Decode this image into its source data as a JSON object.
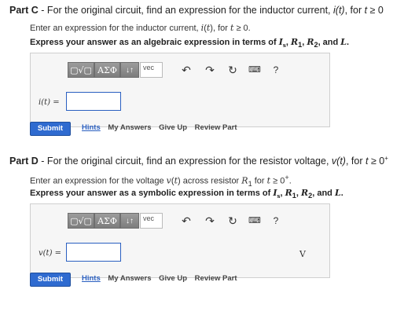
{
  "part_c": {
    "label": "Part C",
    "header": "For the original circuit, find an expression for the inductor current, i(t), for t ≥ 0",
    "instruction_text": "Enter an expression for the inductor current, i(t), for t ≥ 0.",
    "express_text": "Express your answer as an algebraic expression in terms of Is, R1, R2, and L.",
    "eq_label": "i(t) =",
    "input_value": "",
    "unit": "",
    "submit": "Submit",
    "links": [
      "Hints",
      "My Answers",
      "Give Up",
      "Review Part"
    ]
  },
  "part_d": {
    "label": "Part D",
    "header": "For the original circuit, find an expression for the resistor voltage, v(t), for t ≥ 0+",
    "instruction_text": "Enter an expression for the voltage v(t) across resistor R1 for t ≥ 0+.",
    "express_text": "Express your answer as a symbolic expression in terms of Is, R1, R2, and L.",
    "eq_label": "v(t) =",
    "input_value": "",
    "unit": "V",
    "submit": "Submit",
    "links": [
      "Hints",
      "My Answers",
      "Give Up",
      "Review Part"
    ]
  },
  "toolbar": {
    "radical": "▢√▢",
    "greek": "ΑΣΦ",
    "arrows": "↓↑",
    "vec": "vec",
    "icons": [
      "undo-icon",
      "redo-icon",
      "reset-icon",
      "keyboard-icon",
      "help-icon"
    ],
    "help": "?"
  },
  "colors": {
    "accent": "#2f6bd0",
    "link": "#2a5fc0",
    "toolbar_bg": "#8a8a8a",
    "editor_bg": "#f6f6f6"
  }
}
